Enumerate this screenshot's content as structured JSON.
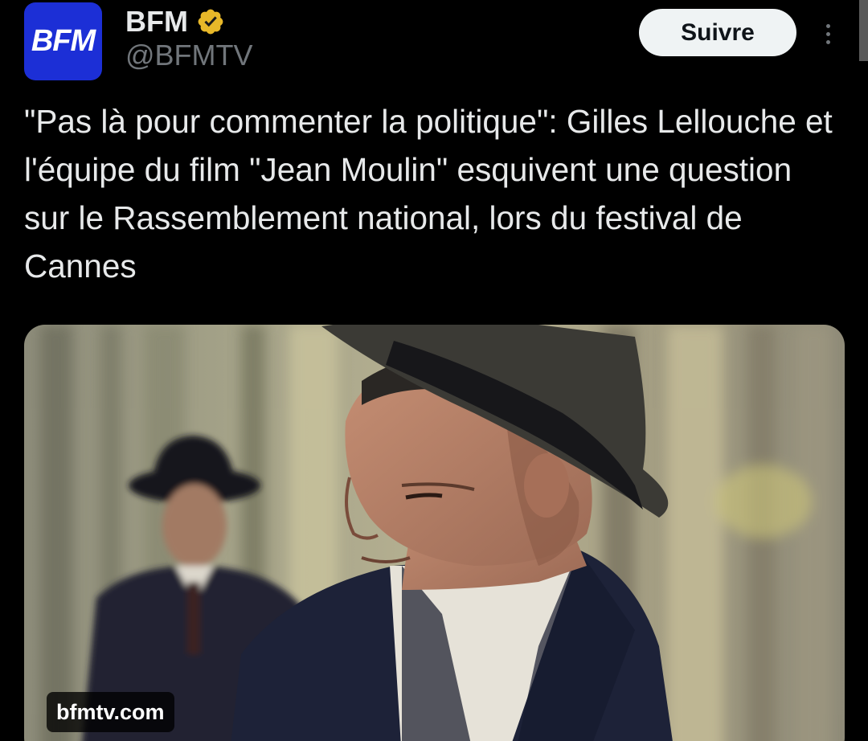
{
  "author": {
    "display_name": "BFM",
    "handle": "@BFMTV",
    "avatar_text": "BFM",
    "verified_icon": "gold-verified-badge-icon",
    "avatar_color": "#1c2fd6",
    "verified_color": "#e8b829"
  },
  "actions": {
    "follow_label": "Suivre",
    "more_icon": "more-vertical-icon"
  },
  "tweet": {
    "text": "\"Pas là pour commenter la politique\": Gilles Lellouche et l'équipe du film \"Jean Moulin\" esquivent une question sur le Rassemblement national, lors du festival de Cannes"
  },
  "media": {
    "domain": "bfmtv.com"
  },
  "colors": {
    "background": "#000000",
    "primary_text": "#e7e9ea",
    "secondary_text": "#71767b",
    "follow_button_bg": "#eff3f4"
  }
}
